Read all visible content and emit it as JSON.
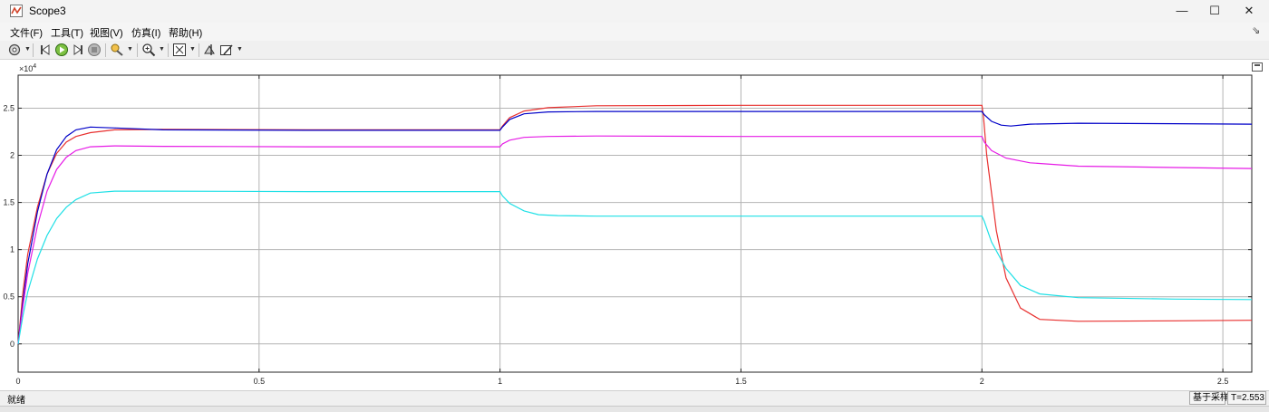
{
  "window": {
    "title": "Scope3",
    "minimize_glyph": "—",
    "maximize_glyph": "☐",
    "close_glyph": "✕"
  },
  "menu": {
    "items": [
      {
        "label": "文件(F)"
      },
      {
        "label": "工具(T)"
      },
      {
        "label": "视图(V)"
      },
      {
        "label": "仿真(I)"
      },
      {
        "label": "帮助(H)"
      }
    ],
    "pin_glyph": "⇘"
  },
  "toolbar": {
    "icons": [
      "settings-icon",
      "step-back-icon",
      "run-icon",
      "step-forward-icon",
      "stop-icon",
      "highlight-icon",
      "zoom-icon",
      "autoscale-icon",
      "cursor-measure-icon",
      "style-edit-icon"
    ]
  },
  "colors": {
    "red": "#e8302f",
    "blue": "#0000c8",
    "magenta": "#e61be6",
    "cyan": "#1fe0e6"
  },
  "chart_data": {
    "type": "line",
    "exponent_label": "×10",
    "exponent_power": "4",
    "xlim": [
      0,
      2.56
    ],
    "ylim": [
      -0.3,
      2.85
    ],
    "x_ticks": [
      0,
      0.5,
      1,
      1.5,
      2,
      2.5
    ],
    "x_tick_labels": [
      "0",
      "0.5",
      "1",
      "1.5",
      "2",
      "2.5"
    ],
    "y_ticks": [
      0,
      0.5,
      1,
      1.5,
      2,
      2.5
    ],
    "y_tick_labels": [
      "0",
      "0.5",
      "1",
      "1.5",
      "2",
      "2.5"
    ],
    "grid": true,
    "series": [
      {
        "color": "#e8302f",
        "points": [
          [
            0,
            0
          ],
          [
            0.01,
            0.55
          ],
          [
            0.02,
            0.95
          ],
          [
            0.04,
            1.45
          ],
          [
            0.06,
            1.8
          ],
          [
            0.08,
            2.02
          ],
          [
            0.1,
            2.14
          ],
          [
            0.12,
            2.2
          ],
          [
            0.15,
            2.24
          ],
          [
            0.2,
            2.27
          ],
          [
            0.3,
            2.275
          ],
          [
            0.6,
            2.27
          ],
          [
            0.8,
            2.27
          ],
          [
            1.0,
            2.27
          ],
          [
            1.005,
            2.31
          ],
          [
            1.02,
            2.4
          ],
          [
            1.05,
            2.47
          ],
          [
            1.1,
            2.505
          ],
          [
            1.2,
            2.525
          ],
          [
            1.5,
            2.53
          ],
          [
            2.0,
            2.53
          ],
          [
            2.003,
            2.42
          ],
          [
            2.01,
            2.0
          ],
          [
            2.03,
            1.2
          ],
          [
            2.05,
            0.7
          ],
          [
            2.08,
            0.38
          ],
          [
            2.12,
            0.26
          ],
          [
            2.2,
            0.24
          ],
          [
            2.4,
            0.245
          ],
          [
            2.56,
            0.25
          ]
        ]
      },
      {
        "color": "#0000c8",
        "points": [
          [
            0,
            0
          ],
          [
            0.01,
            0.45
          ],
          [
            0.02,
            0.85
          ],
          [
            0.04,
            1.4
          ],
          [
            0.06,
            1.8
          ],
          [
            0.08,
            2.06
          ],
          [
            0.1,
            2.2
          ],
          [
            0.12,
            2.27
          ],
          [
            0.15,
            2.3
          ],
          [
            0.2,
            2.29
          ],
          [
            0.3,
            2.27
          ],
          [
            0.6,
            2.265
          ],
          [
            0.8,
            2.265
          ],
          [
            1.0,
            2.265
          ],
          [
            1.005,
            2.3
          ],
          [
            1.02,
            2.38
          ],
          [
            1.05,
            2.44
          ],
          [
            1.1,
            2.46
          ],
          [
            1.2,
            2.465
          ],
          [
            1.5,
            2.465
          ],
          [
            2.0,
            2.465
          ],
          [
            2.005,
            2.43
          ],
          [
            2.02,
            2.36
          ],
          [
            2.04,
            2.32
          ],
          [
            2.06,
            2.31
          ],
          [
            2.1,
            2.33
          ],
          [
            2.2,
            2.34
          ],
          [
            2.4,
            2.335
          ],
          [
            2.56,
            2.33
          ]
        ]
      },
      {
        "color": "#e61be6",
        "points": [
          [
            0,
            0
          ],
          [
            0.01,
            0.4
          ],
          [
            0.02,
            0.75
          ],
          [
            0.04,
            1.25
          ],
          [
            0.06,
            1.62
          ],
          [
            0.08,
            1.85
          ],
          [
            0.1,
            1.98
          ],
          [
            0.12,
            2.05
          ],
          [
            0.15,
            2.09
          ],
          [
            0.2,
            2.1
          ],
          [
            0.3,
            2.095
          ],
          [
            0.6,
            2.09
          ],
          [
            0.8,
            2.09
          ],
          [
            1.0,
            2.09
          ],
          [
            1.005,
            2.12
          ],
          [
            1.02,
            2.16
          ],
          [
            1.05,
            2.19
          ],
          [
            1.1,
            2.2
          ],
          [
            1.2,
            2.205
          ],
          [
            1.5,
            2.2
          ],
          [
            2.0,
            2.2
          ],
          [
            2.005,
            2.14
          ],
          [
            2.02,
            2.05
          ],
          [
            2.05,
            1.97
          ],
          [
            2.1,
            1.92
          ],
          [
            2.2,
            1.885
          ],
          [
            2.4,
            1.87
          ],
          [
            2.56,
            1.86
          ]
        ]
      },
      {
        "color": "#1fe0e6",
        "points": [
          [
            0,
            0
          ],
          [
            0.01,
            0.3
          ],
          [
            0.02,
            0.55
          ],
          [
            0.04,
            0.9
          ],
          [
            0.06,
            1.15
          ],
          [
            0.08,
            1.33
          ],
          [
            0.1,
            1.45
          ],
          [
            0.12,
            1.53
          ],
          [
            0.15,
            1.6
          ],
          [
            0.2,
            1.62
          ],
          [
            0.3,
            1.62
          ],
          [
            0.6,
            1.615
          ],
          [
            0.8,
            1.615
          ],
          [
            1.0,
            1.615
          ],
          [
            1.005,
            1.57
          ],
          [
            1.02,
            1.49
          ],
          [
            1.05,
            1.41
          ],
          [
            1.08,
            1.37
          ],
          [
            1.12,
            1.36
          ],
          [
            1.2,
            1.355
          ],
          [
            1.5,
            1.355
          ],
          [
            2.0,
            1.355
          ],
          [
            2.005,
            1.3
          ],
          [
            2.02,
            1.08
          ],
          [
            2.05,
            0.8
          ],
          [
            2.08,
            0.62
          ],
          [
            2.12,
            0.53
          ],
          [
            2.2,
            0.49
          ],
          [
            2.4,
            0.475
          ],
          [
            2.56,
            0.47
          ]
        ]
      }
    ]
  },
  "status": {
    "left": "就绪",
    "sampling": "基于采样",
    "time": "T=2.553"
  }
}
